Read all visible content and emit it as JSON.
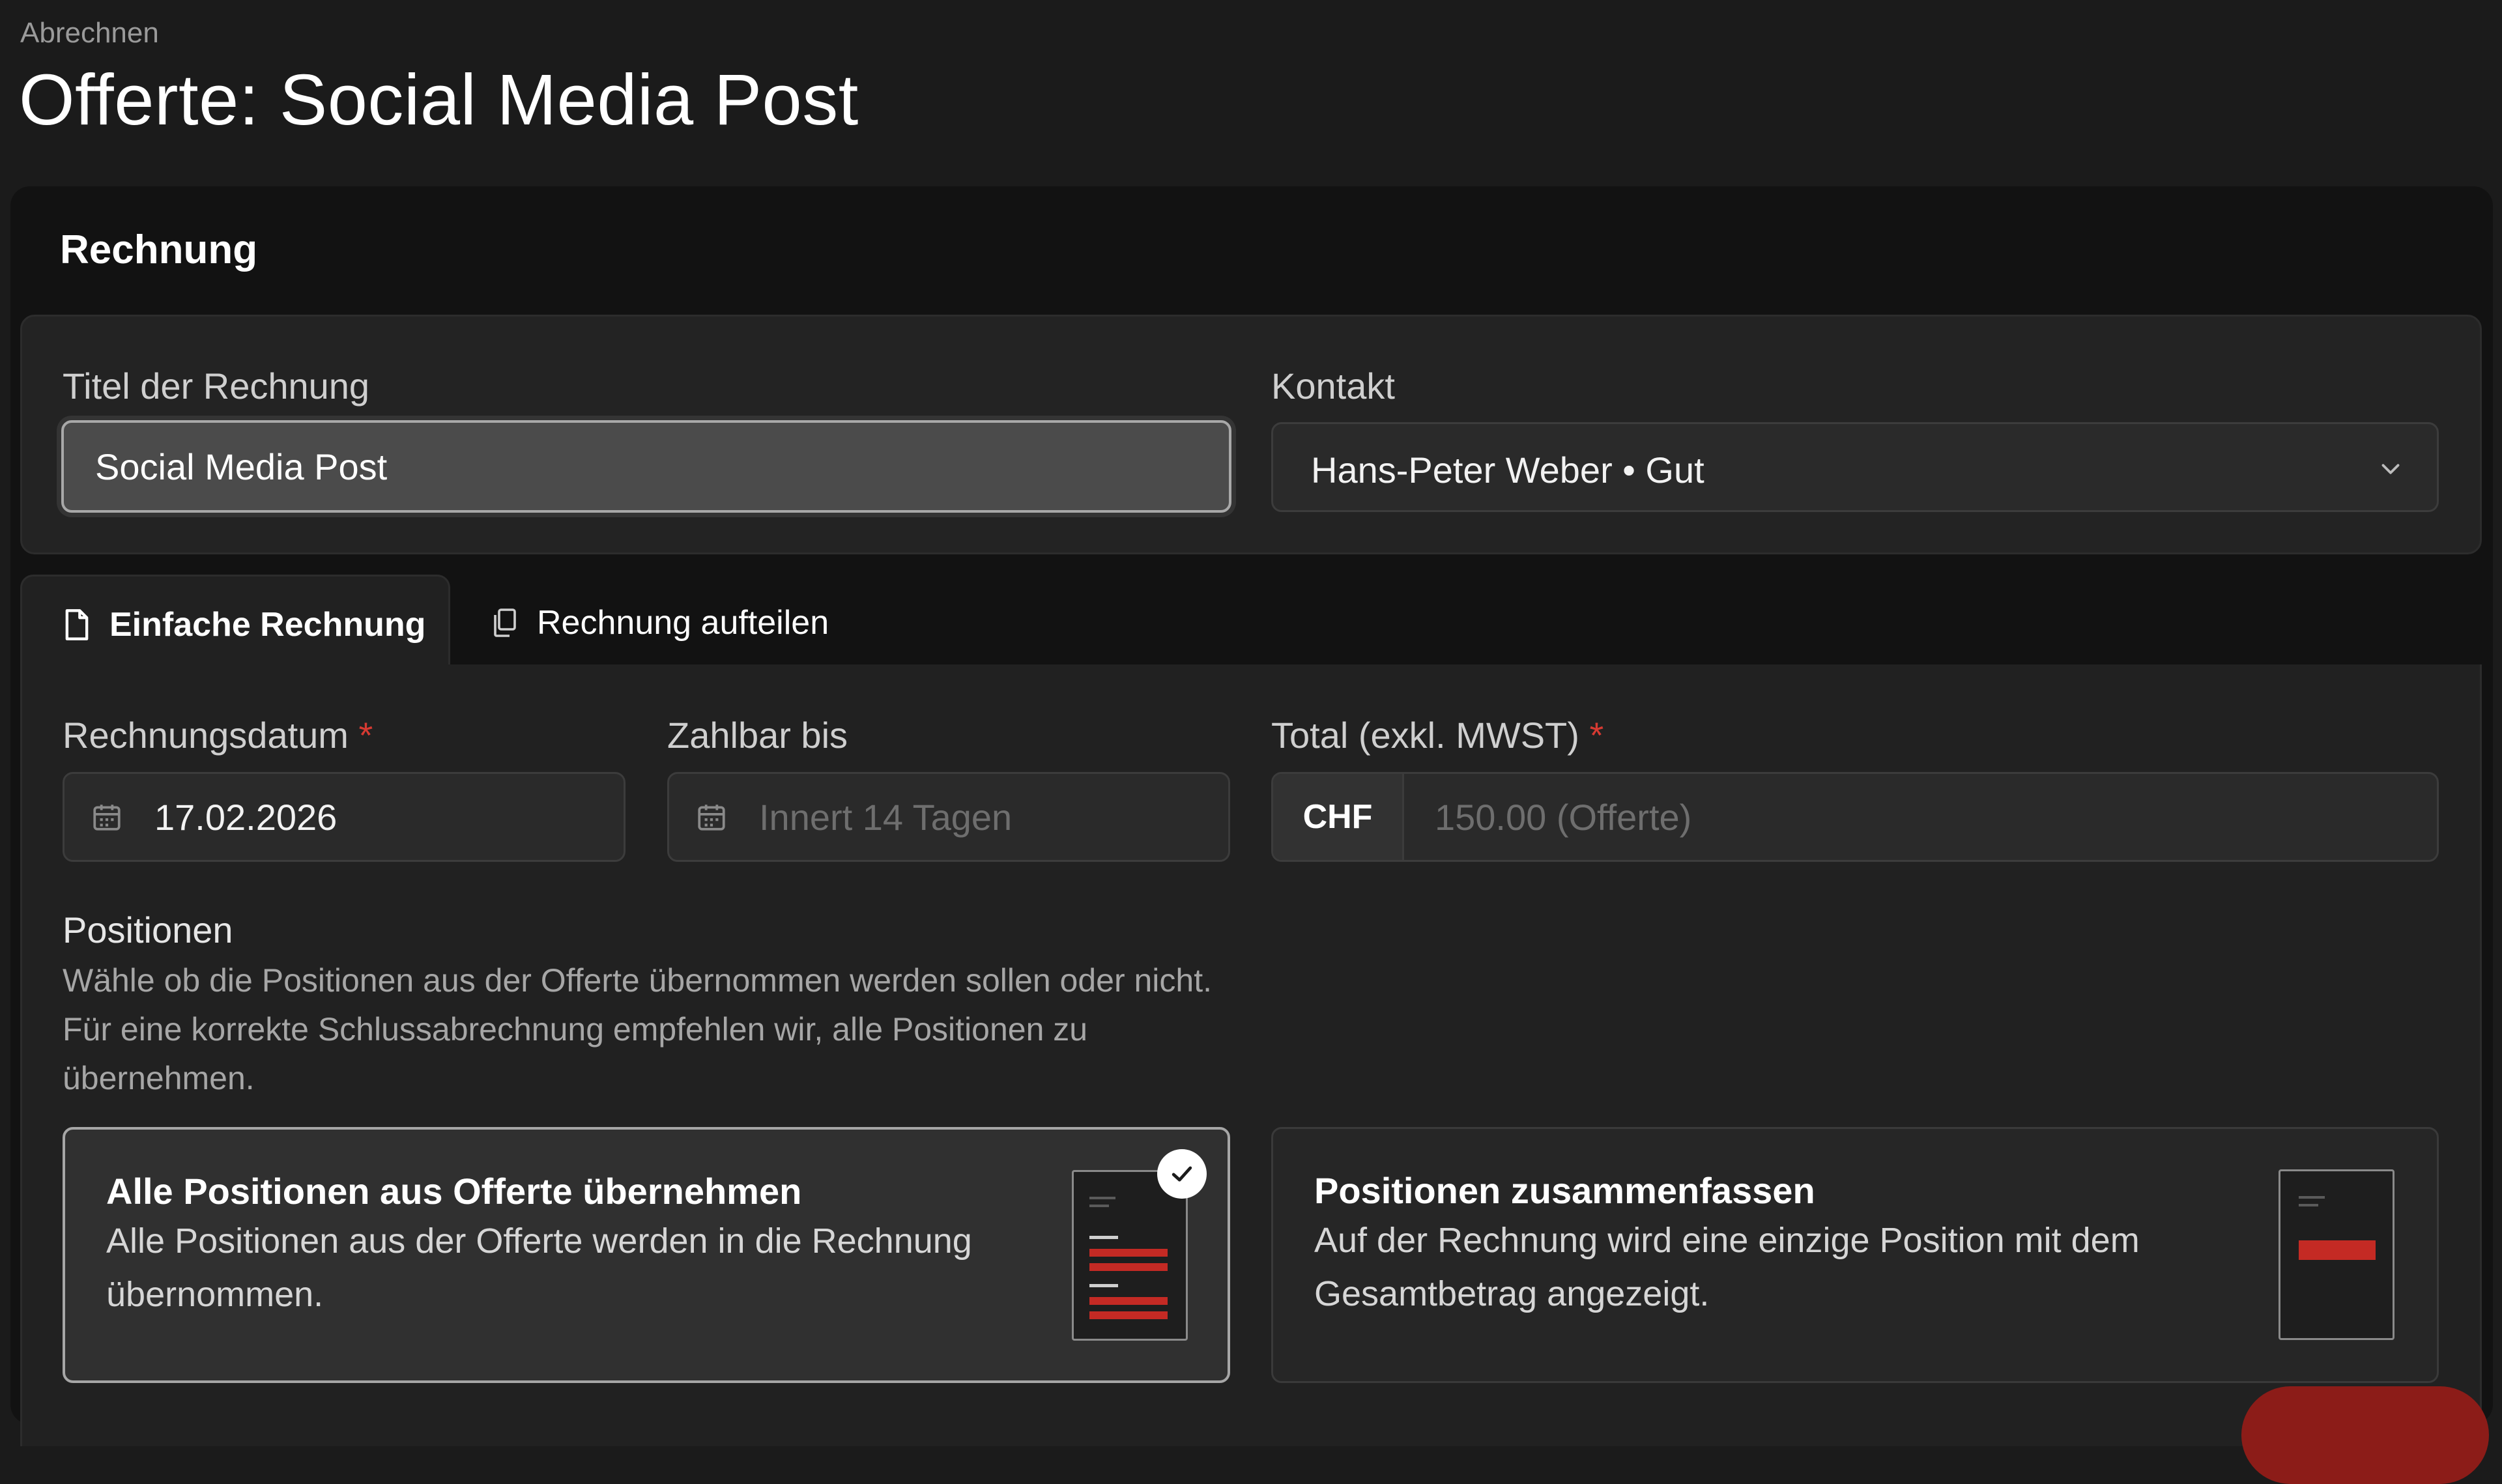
{
  "header": {
    "breadcrumb": "Abrechnen",
    "title": "Offerte: Social Media Post"
  },
  "card": {
    "title": "Rechnung"
  },
  "form": {
    "title_label": "Titel der Rechnung",
    "title_value": "Social Media Post",
    "contact_label": "Kontakt",
    "contact_value": "Hans-Peter Weber • Gut"
  },
  "tabs": [
    {
      "label": "Einfache Rechnung",
      "active": true,
      "icon": "document-icon"
    },
    {
      "label": "Rechnung aufteilen",
      "active": false,
      "icon": "copy-icon"
    }
  ],
  "invoice": {
    "date_label": "Rechnungsdatum",
    "date_required_mark": "*",
    "date_value": "17.02.2026",
    "due_label": "Zahlbar bis",
    "due_placeholder": "Innert 14 Tagen",
    "total_label": "Total (exkl. MWST)",
    "total_required_mark": "*",
    "currency": "CHF",
    "total_placeholder": "150.00 (Offerte)"
  },
  "positions": {
    "title": "Positionen",
    "description": "Wähle ob die Positionen aus der Offerte übernommen werden sollen oder nicht. Für eine korrekte Schlussabrechnung empfehlen wir, alle Positionen zu übernehmen.",
    "options": [
      {
        "title": "Alle Positionen aus Offerte übernehmen",
        "description": "Alle Positionen aus der Offerte werden in die Rechnung übernommen.",
        "selected": true
      },
      {
        "title": "Positionen zusammenfassen",
        "description": "Auf der Rechnung wird eine einzige Position mit dem Gesamtbetrag angezeigt.",
        "selected": false
      }
    ]
  },
  "colors": {
    "background": "#1b1b1b",
    "card": "#121212",
    "panel": "#232323",
    "accent_red": "#c42a24",
    "required": "#d63a32"
  }
}
